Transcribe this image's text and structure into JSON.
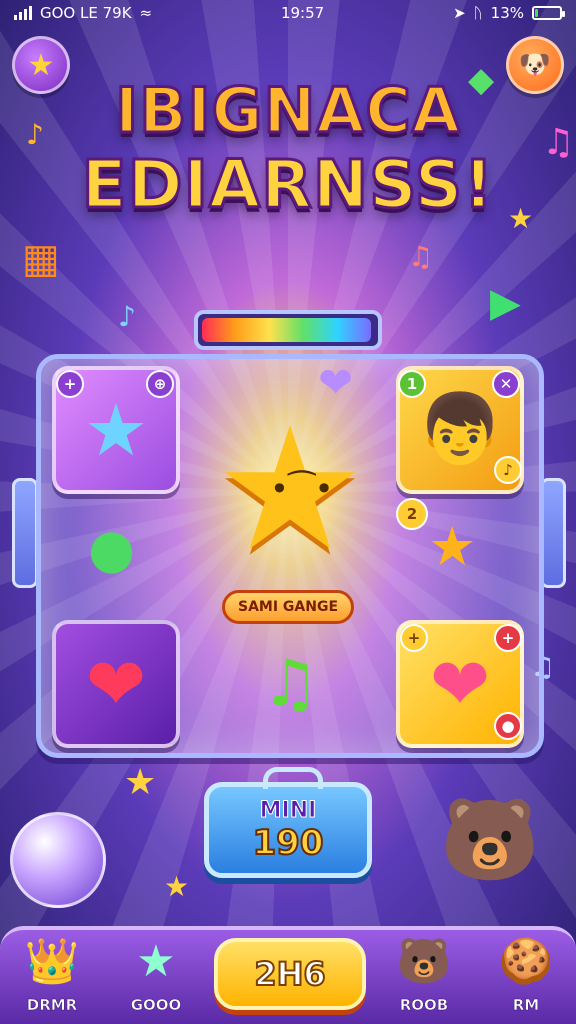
{
  "status_bar": {
    "carrier": "GOO LE 79K",
    "time": "19:57",
    "battery_text": "13%",
    "battery_level": 0.13,
    "accent_color": "#49e04a"
  },
  "header": {
    "star_button_icon": "star-icon",
    "pet_button_icon": "pet-icon",
    "title_line1": "IBIGNACA",
    "title_line2": "EDIARNSS!"
  },
  "level_progress": {
    "fraction": 0.98
  },
  "board": {
    "tile_top_left": {
      "icon": "star-icon",
      "badge_left": "+",
      "badge_right": "⊕"
    },
    "tile_top_right": {
      "icon": "boy-icon",
      "badge_left": "1",
      "badge_right": "✕",
      "badge_corner": "♪"
    },
    "tile_bottom_left": {
      "icon": "balloon-icon"
    },
    "tile_bottom_right": {
      "icon": "heart-gem-icon",
      "badge_left": "+",
      "badge_right": "+",
      "badge_corner": "●"
    },
    "center_star": {
      "icon": "smiling-star-icon"
    },
    "center_label": "SAMI GANGE",
    "side_badge": "2"
  },
  "score_panel": {
    "label": "MINI",
    "value": "190"
  },
  "bottom_nav": {
    "items": [
      {
        "label": "DRMR",
        "icon": "gem-crown-icon"
      },
      {
        "label": "GOOO",
        "icon": "star-badge-icon"
      },
      {
        "label": "2H6",
        "icon": "play-button"
      },
      {
        "label": "ROOB",
        "icon": "blue-pet-icon"
      },
      {
        "label": "RM",
        "icon": "cookie-icon"
      }
    ]
  }
}
